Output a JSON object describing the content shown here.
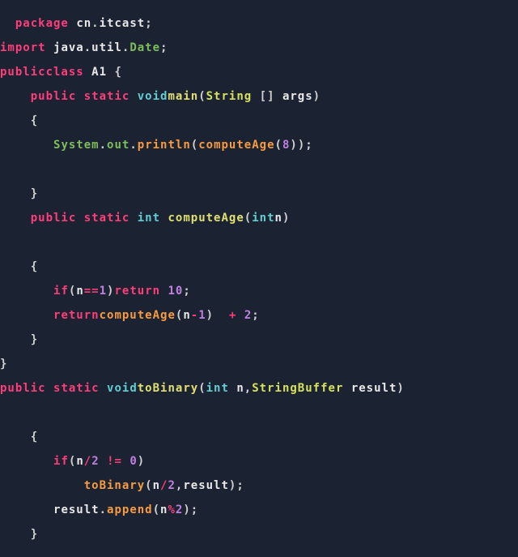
{
  "code": {
    "tokens": [
      [
        [
          "sp",
          "  "
        ],
        [
          "kw",
          "package"
        ],
        [
          "sp",
          " "
        ],
        [
          "id",
          "cn"
        ],
        [
          "punc",
          "."
        ],
        [
          "id",
          "itcast"
        ],
        [
          "punc",
          ";"
        ]
      ],
      [
        [
          "kw",
          "import"
        ],
        [
          "sp",
          " "
        ],
        [
          "id",
          "java"
        ],
        [
          "punc",
          "."
        ],
        [
          "id",
          "util"
        ],
        [
          "punc",
          "."
        ],
        [
          "obj",
          "Date"
        ],
        [
          "punc",
          ";"
        ]
      ],
      [
        [
          "kw",
          "public"
        ],
        [
          "kw",
          "class"
        ],
        [
          "sp",
          " "
        ],
        [
          "id",
          "A1"
        ],
        [
          "sp",
          " "
        ],
        [
          "punc",
          "{"
        ]
      ],
      [
        [
          "sp",
          "    "
        ],
        [
          "kw",
          "public"
        ],
        [
          "sp",
          " "
        ],
        [
          "kw",
          "static"
        ],
        [
          "sp",
          " "
        ],
        [
          "type",
          "void"
        ],
        [
          "mth",
          "main"
        ],
        [
          "punc",
          "("
        ],
        [
          "typeY",
          "String"
        ],
        [
          "sp",
          " "
        ],
        [
          "punc",
          "[]"
        ],
        [
          "sp",
          " "
        ],
        [
          "id",
          "args"
        ],
        [
          "punc",
          ")"
        ]
      ],
      [
        [
          "sp",
          "    "
        ],
        [
          "punc",
          "{"
        ]
      ],
      [
        [
          "sp",
          "       "
        ],
        [
          "obj",
          "System"
        ],
        [
          "punc",
          "."
        ],
        [
          "obj",
          "out"
        ],
        [
          "punc",
          "."
        ],
        [
          "call",
          "println"
        ],
        [
          "punc",
          "("
        ],
        [
          "call",
          "computeAge"
        ],
        [
          "punc",
          "("
        ],
        [
          "num",
          "8"
        ],
        [
          "punc",
          "))"
        ],
        [
          "punc",
          ";"
        ]
      ],
      [
        [
          "sp",
          " "
        ]
      ],
      [
        [
          "sp",
          "    "
        ],
        [
          "punc",
          "}"
        ]
      ],
      [
        [
          "sp",
          "    "
        ],
        [
          "kw",
          "public"
        ],
        [
          "sp",
          " "
        ],
        [
          "kw",
          "static"
        ],
        [
          "sp",
          " "
        ],
        [
          "type",
          "int"
        ],
        [
          "sp",
          " "
        ],
        [
          "mth",
          "computeAge"
        ],
        [
          "punc",
          "("
        ],
        [
          "type",
          "int"
        ],
        [
          "id",
          "n"
        ],
        [
          "punc",
          ")"
        ]
      ],
      [
        [
          "sp",
          " "
        ]
      ],
      [
        [
          "sp",
          "    "
        ],
        [
          "punc",
          "{"
        ]
      ],
      [
        [
          "sp",
          "       "
        ],
        [
          "kw",
          "if"
        ],
        [
          "punc",
          "("
        ],
        [
          "id",
          "n"
        ],
        [
          "op",
          "=="
        ],
        [
          "num",
          "1"
        ],
        [
          "punc",
          ")"
        ],
        [
          "kw",
          "return"
        ],
        [
          "sp",
          " "
        ],
        [
          "num",
          "10"
        ],
        [
          "punc",
          ";"
        ]
      ],
      [
        [
          "sp",
          "       "
        ],
        [
          "kw",
          "return"
        ],
        [
          "call",
          "computeAge"
        ],
        [
          "punc",
          "("
        ],
        [
          "id",
          "n"
        ],
        [
          "op",
          "-"
        ],
        [
          "num",
          "1"
        ],
        [
          "punc",
          ")"
        ],
        [
          "sp",
          "  "
        ],
        [
          "op",
          "+"
        ],
        [
          "sp",
          " "
        ],
        [
          "num",
          "2"
        ],
        [
          "punc",
          ";"
        ]
      ],
      [
        [
          "sp",
          "    "
        ],
        [
          "punc",
          "}"
        ]
      ],
      [
        [
          "punc",
          "}"
        ]
      ],
      [
        [
          "kw",
          "public"
        ],
        [
          "sp",
          " "
        ],
        [
          "kw",
          "static"
        ],
        [
          "sp",
          " "
        ],
        [
          "type",
          "void"
        ],
        [
          "mth",
          "toBinary"
        ],
        [
          "punc",
          "("
        ],
        [
          "type",
          "int"
        ],
        [
          "sp",
          " "
        ],
        [
          "id",
          "n"
        ],
        [
          "punc",
          ","
        ],
        [
          "typeY",
          "StringBuffer"
        ],
        [
          "sp",
          " "
        ],
        [
          "id",
          "result"
        ],
        [
          "punc",
          ")"
        ]
      ],
      [
        [
          "sp",
          " "
        ]
      ],
      [
        [
          "sp",
          "    "
        ],
        [
          "punc",
          "{"
        ]
      ],
      [
        [
          "sp",
          "       "
        ],
        [
          "kw",
          "if"
        ],
        [
          "punc",
          "("
        ],
        [
          "id",
          "n"
        ],
        [
          "op",
          "/"
        ],
        [
          "num",
          "2"
        ],
        [
          "sp",
          " "
        ],
        [
          "op",
          "!="
        ],
        [
          "sp",
          " "
        ],
        [
          "num",
          "0"
        ],
        [
          "punc",
          ")"
        ]
      ],
      [
        [
          "sp",
          "           "
        ],
        [
          "call",
          "toBinary"
        ],
        [
          "punc",
          "("
        ],
        [
          "id",
          "n"
        ],
        [
          "op",
          "/"
        ],
        [
          "num",
          "2"
        ],
        [
          "punc",
          ","
        ],
        [
          "id",
          "result"
        ],
        [
          "punc",
          ")"
        ],
        [
          "punc",
          ";"
        ]
      ],
      [
        [
          "sp",
          "       "
        ],
        [
          "id",
          "result"
        ],
        [
          "punc",
          "."
        ],
        [
          "call",
          "append"
        ],
        [
          "punc",
          "("
        ],
        [
          "id",
          "n"
        ],
        [
          "op",
          "%"
        ],
        [
          "num",
          "2"
        ],
        [
          "punc",
          ")"
        ],
        [
          "punc",
          ";"
        ]
      ],
      [
        [
          "sp",
          "    "
        ],
        [
          "punc",
          "}"
        ]
      ]
    ]
  }
}
